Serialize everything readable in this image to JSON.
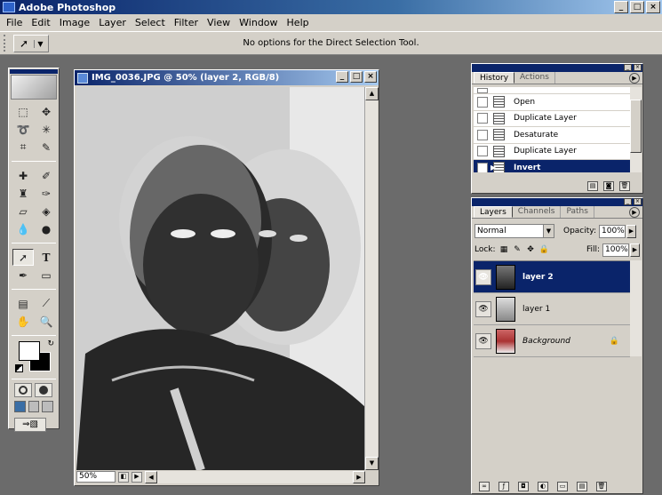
{
  "app": {
    "title": "Adobe Photoshop"
  },
  "menu": [
    "File",
    "Edit",
    "Image",
    "Layer",
    "Select",
    "Filter",
    "View",
    "Window",
    "Help"
  ],
  "options_bar": {
    "message": "No options for the Direct Selection Tool."
  },
  "document": {
    "title": "IMG_0036.JPG @ 50% (layer 2, RGB/8)",
    "zoom": "50%"
  },
  "history": {
    "tabs": [
      "History",
      "Actions"
    ],
    "items": [
      {
        "label": "Open",
        "selected": false
      },
      {
        "label": "Duplicate Layer",
        "selected": false
      },
      {
        "label": "Desaturate",
        "selected": false
      },
      {
        "label": "Duplicate Layer",
        "selected": false
      },
      {
        "label": "Invert",
        "selected": true
      }
    ]
  },
  "layers": {
    "tabs": [
      "Layers",
      "Channels",
      "Paths"
    ],
    "blend_mode": "Normal",
    "opacity_label": "Opacity:",
    "opacity": "100%",
    "lock_label": "Lock:",
    "fill_label": "Fill:",
    "fill": "100%",
    "items": [
      {
        "name": "layer 2",
        "selected": true
      },
      {
        "name": "layer 1",
        "selected": false
      },
      {
        "name": "Background",
        "selected": false,
        "locked": true
      }
    ]
  },
  "colors": {
    "accent": "#0a246a",
    "chrome": "#d4d0c8",
    "workspace": "#6b6b6b"
  }
}
